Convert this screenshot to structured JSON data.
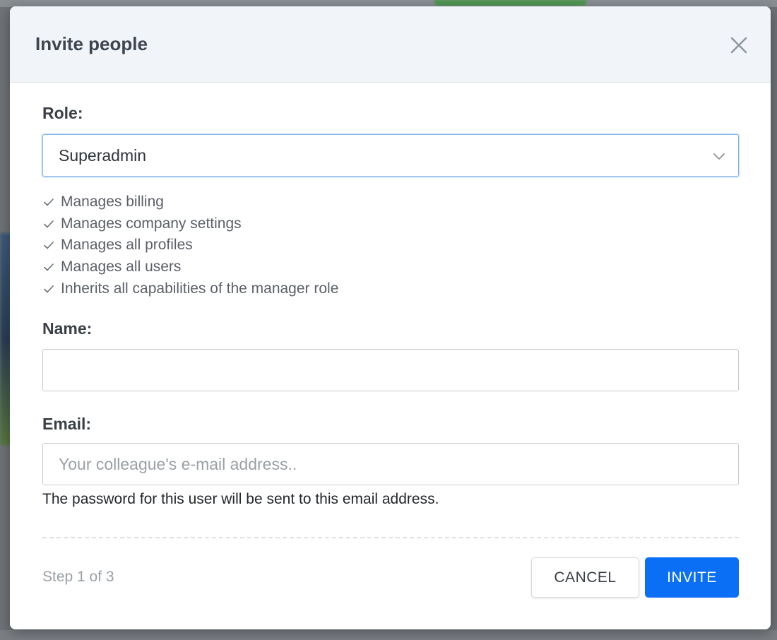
{
  "modal": {
    "title": "Invite people"
  },
  "role": {
    "label": "Role:",
    "selected": "Superadmin",
    "capabilities": [
      "Manages billing",
      "Manages company settings",
      "Manages all profiles",
      "Manages all users",
      "Inherits all capabilities of the manager role"
    ]
  },
  "name": {
    "label": "Name:",
    "value": "",
    "placeholder": ""
  },
  "email": {
    "label": "Email:",
    "value": "",
    "placeholder": "Your colleague's e-mail address..",
    "help": "The password for this user will be sent to this email address."
  },
  "footer": {
    "step": "Step 1 of 3",
    "cancel_label": "CANCEL",
    "invite_label": "INVITE"
  },
  "colors": {
    "primary": "#0a6ff5",
    "header_bg": "#f1f5f9",
    "focus_border": "#7fb2e8"
  },
  "icons": {
    "close": "close-icon",
    "dropdown": "chevron-down-icon",
    "capability": "checkmark-icon"
  }
}
